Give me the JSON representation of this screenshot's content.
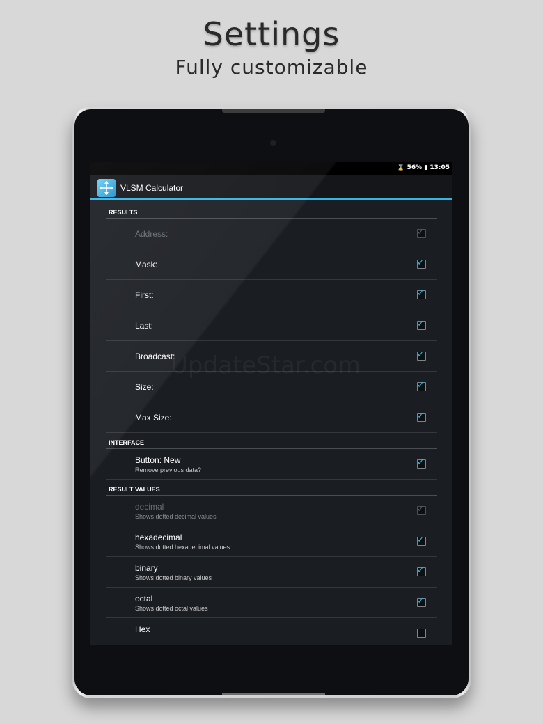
{
  "hero": {
    "title": "Settings",
    "subtitle": "Fully customizable"
  },
  "statusbar": {
    "text": "⌛ 56% ▮ 13:05"
  },
  "actionbar": {
    "title": "VLSM Calculator"
  },
  "sections": {
    "results": "RESULTS",
    "interface": "INTERFACE",
    "result_values": "RESULT VALUES"
  },
  "results": [
    {
      "title": "Address:",
      "checked": true,
      "enabled": false
    },
    {
      "title": "Mask:",
      "checked": true,
      "enabled": true
    },
    {
      "title": "First:",
      "checked": true,
      "enabled": true
    },
    {
      "title": "Last:",
      "checked": true,
      "enabled": true
    },
    {
      "title": "Broadcast:",
      "checked": true,
      "enabled": true
    },
    {
      "title": "Size:",
      "checked": true,
      "enabled": true
    },
    {
      "title": "Max Size:",
      "checked": true,
      "enabled": true
    }
  ],
  "interface": [
    {
      "title": "Button: New",
      "summary": "Remove previous data?",
      "checked": true,
      "enabled": true
    }
  ],
  "result_values": [
    {
      "title": "decimal",
      "summary": "Shows dotted decimal values",
      "checked": true,
      "enabled": false
    },
    {
      "title": "hexadecimal",
      "summary": "Shows dotted hexadecimal values",
      "checked": true,
      "enabled": true
    },
    {
      "title": "binary",
      "summary": "Shows dotted binary values",
      "checked": true,
      "enabled": true
    },
    {
      "title": "octal",
      "summary": "Shows dotted octal values",
      "checked": true,
      "enabled": true
    },
    {
      "title": "Hex",
      "summary": "",
      "checked": false,
      "enabled": true
    }
  ],
  "watermark": "UpdateStar.com",
  "colors": {
    "accent": "#33b5e5",
    "background": "#1a1d22"
  }
}
